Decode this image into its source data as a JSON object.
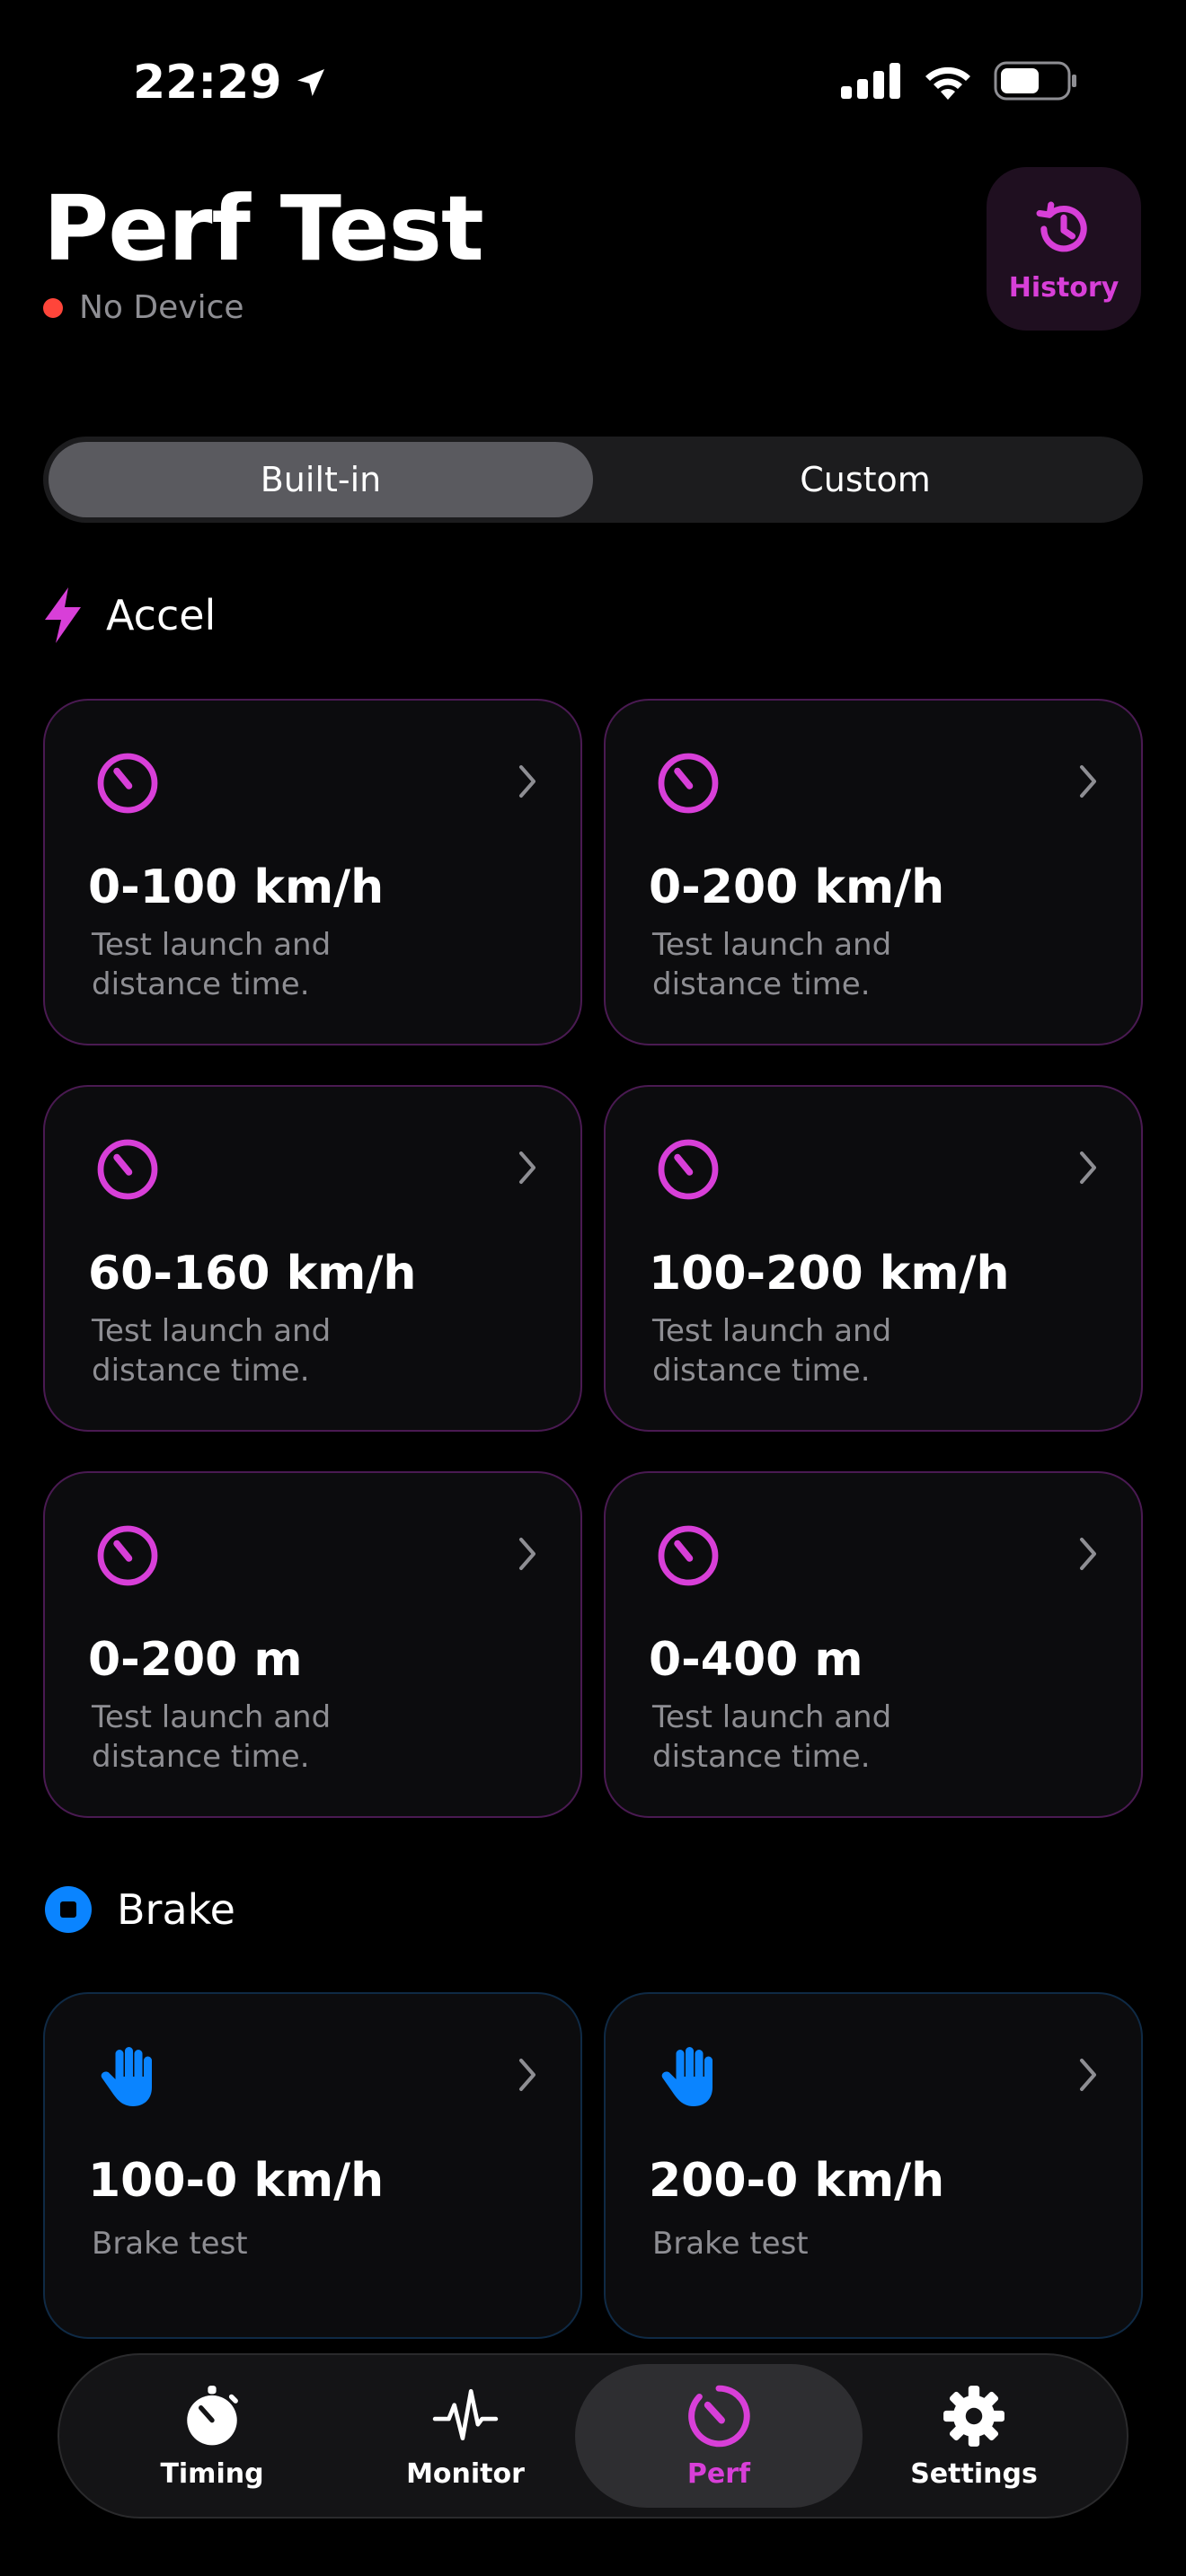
{
  "status_bar": {
    "time": "22:29"
  },
  "header": {
    "title": "Perf Test",
    "device_status": "No Device",
    "history_label": "History"
  },
  "segmented": {
    "options": [
      "Built-in",
      "Custom"
    ],
    "selected": "Built-in"
  },
  "sections": {
    "accel": {
      "title": "Accel",
      "icon": "lightning-bolt-icon",
      "color": "#d83fd8",
      "cards": [
        {
          "title": "0-100 km/h",
          "desc": "Test launch and\n distance time."
        },
        {
          "title": "0-200 km/h",
          "desc": "Test launch and\n distance time."
        },
        {
          "title": "60-160 km/h",
          "desc": "Test launch and\n distance time."
        },
        {
          "title": "100-200 km/h",
          "desc": "Test launch and\n distance time."
        },
        {
          "title": "0-200 m",
          "desc": "Test launch and\n distance time."
        },
        {
          "title": "0-400 m",
          "desc": "Test launch and\n distance time."
        }
      ]
    },
    "brake": {
      "title": "Brake",
      "icon": "stop-circle-icon",
      "color": "#0a84ff",
      "cards": [
        {
          "title": "100-0 km/h",
          "desc": "Brake test"
        },
        {
          "title": "200-0 km/h",
          "desc": "Brake test"
        }
      ]
    }
  },
  "tab_bar": {
    "tabs": [
      {
        "label": "Timing",
        "icon": "stopwatch-icon"
      },
      {
        "label": "Monitor",
        "icon": "pulse-icon"
      },
      {
        "label": "Perf",
        "icon": "speedometer-icon"
      },
      {
        "label": "Settings",
        "icon": "gear-icon"
      }
    ],
    "active": "Perf"
  }
}
